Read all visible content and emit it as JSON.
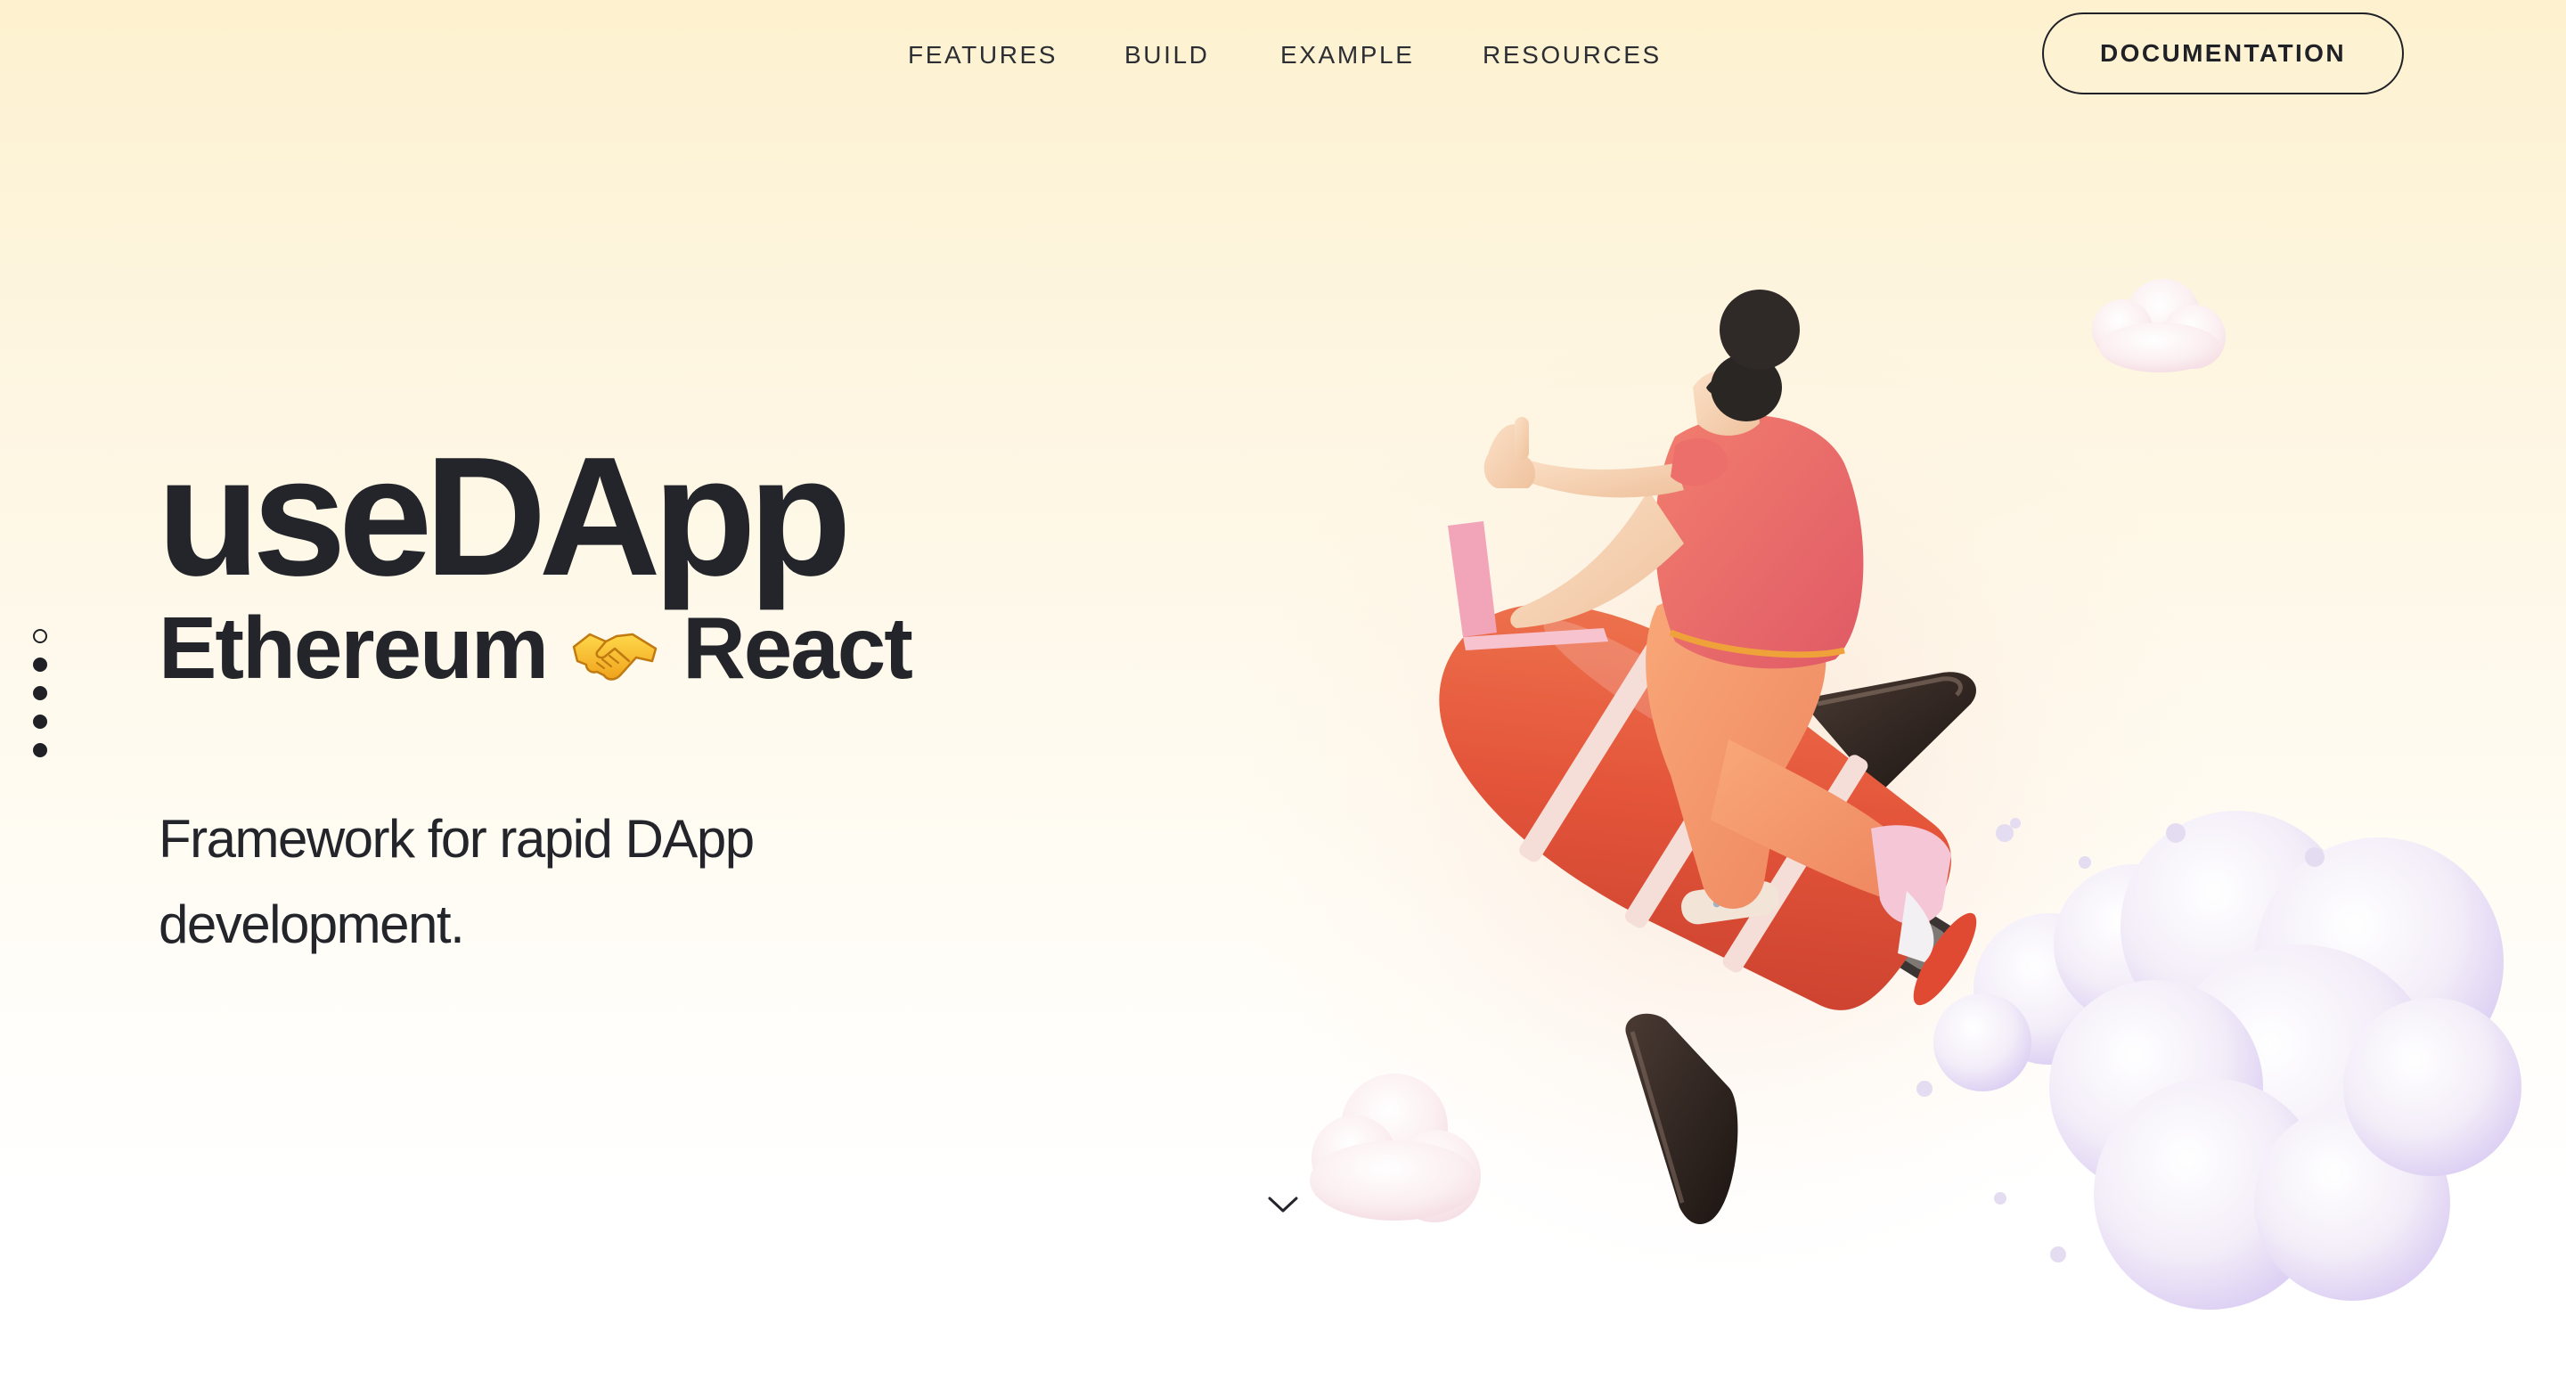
{
  "nav": {
    "links": [
      {
        "label": "FEATURES"
      },
      {
        "label": "BUILD"
      },
      {
        "label": "EXAMPLE"
      },
      {
        "label": "RESOURCES"
      }
    ],
    "cta_label": "DOCUMENTATION"
  },
  "side_nav": {
    "dot_count": 5,
    "active_index": 0
  },
  "hero": {
    "title": "useDApp",
    "subtitle_left": "Ethereum",
    "subtitle_icon": "handshake-icon",
    "subtitle_right": "React",
    "description": "Framework for rapid DApp development."
  },
  "icons": {
    "scroll": "chevron-down-icon",
    "illustration": "rocket-rider-illustration"
  },
  "colors": {
    "text": "#23252b",
    "background_top": "#fdf1cf",
    "background_bottom": "#ffffff",
    "rocket": "#e8573a",
    "shirt": "#e8636a",
    "cloud": "#eee6f6"
  }
}
